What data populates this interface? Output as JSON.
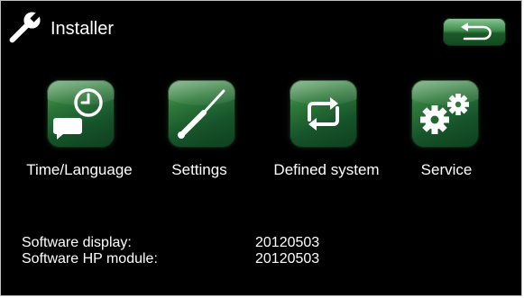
{
  "header": {
    "title": "Installer",
    "icon": "wrench-icon",
    "back_icon": "return-arrow-icon"
  },
  "menu": [
    {
      "label": "Time/Language",
      "icon": "clock-speech-bubble-icon"
    },
    {
      "label": "Settings",
      "icon": "screwdriver-icon"
    },
    {
      "label": "Defined system",
      "icon": "cycle-arrows-icon"
    },
    {
      "label": "Service",
      "icon": "gears-icon"
    }
  ],
  "info": [
    {
      "label": "Software display:",
      "value": "20120503"
    },
    {
      "label": "Software HP module:",
      "value": "20120503"
    }
  ],
  "colors": {
    "background": "#000000",
    "tile_green": "#2f7a3b",
    "text": "#ffffff"
  }
}
